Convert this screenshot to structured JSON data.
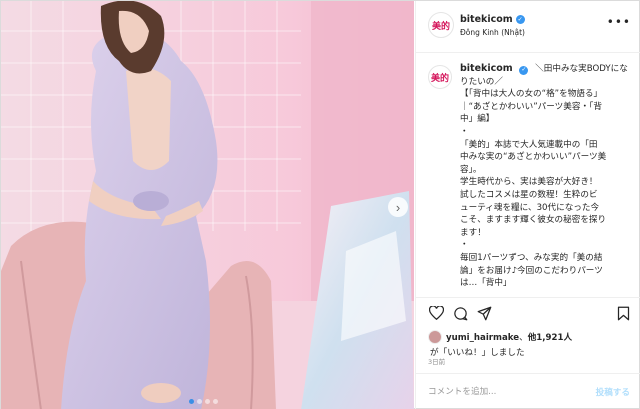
{
  "account": {
    "avatar_text": "美的",
    "username": "bitekicom",
    "location": "Đông Kinh (Nhật)"
  },
  "caption": {
    "lines": [
      "＼田中みな実BODYにな",
      "りたいの／",
      "【「背中は大人の女の“格”を物語る」",
      "｜“あざとかわいい”パーツ美容・「背",
      "中」編】",
      "・",
      "「美的」本誌で大人気連載中の「田",
      "中みな実の“あざとかわいい”パーツ美",
      "容」。",
      "学生時代から、実は美容が大好き！",
      "試したコスメは星の数程！生粋のビ",
      "ューティ魂を糧に、30代になった今",
      "こそ、ますます輝く彼女の秘密を探り",
      "ます！",
      "・",
      "毎回1パーツずつ、みな実的「美の結",
      "論」をお届け♪今回のこだわりパーツ",
      "は…「背中」"
    ]
  },
  "likes": {
    "liker": "yumi_hairmake",
    "connector": "、",
    "others": "他1,921人",
    "line2": "が「いいね！」しました"
  },
  "time": "3日前",
  "comment": {
    "placeholder": "コメントを追加...",
    "post_label": "投稿する"
  },
  "icons": {
    "heart": "heart-icon",
    "comment": "comment-icon",
    "share": "share-icon",
    "bookmark": "bookmark-icon",
    "more": "more-icon",
    "next": "chevron-right-icon"
  },
  "carousel": {
    "slide_count": 4,
    "active_index": 0
  },
  "colors": {
    "verified": "#3897f0",
    "brand": "#d4145a",
    "post_button": "#b2dffc"
  }
}
